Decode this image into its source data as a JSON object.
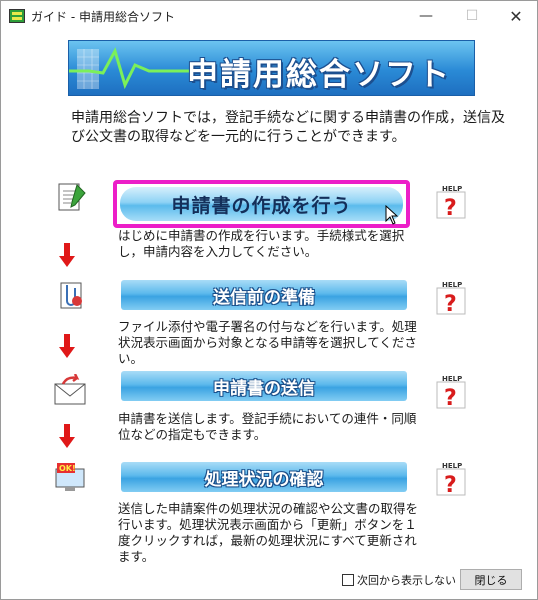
{
  "window": {
    "title": "ガイド - 申請用総合ソフト",
    "minimize_glyph": "—",
    "maximize_glyph": "☐",
    "close_glyph": "✕"
  },
  "banner": {
    "title": "申請用総合ソフト"
  },
  "intro": "申請用総合ソフトでは，登記手続などに関する申請書の作成，送信及び公文書の取得などを一元的に行うことができます。",
  "steps": [
    {
      "label": "申請書の作成を行う",
      "description": "はじめに申請書の作成を行います。手続様式を選択し，申請内容を入力してください。",
      "icon": "document-pencil-icon"
    },
    {
      "label": "送信前の準備",
      "description": "ファイル添付や電子署名の付与などを行います。処理状況表示画面から対象となる申請等を選択してください。",
      "icon": "paperclip-document-icon"
    },
    {
      "label": "申請書の送信",
      "description": "申請書を送信します。登記手続においての連件・同順位などの指定もできます。",
      "icon": "send-mail-icon"
    },
    {
      "label": "処理状況の確認",
      "description": "送信した申請案件の処理状況の確認や公文書の取得を行います。処理状況表示画面から「更新」ボタンを１度クリックすれば，最新の処理状況にすべて更新されます。",
      "icon": "ok-monitor-icon"
    }
  ],
  "help": {
    "label": "HELP",
    "glyph": "?"
  },
  "footer": {
    "checkbox_label": "次回から表示しない",
    "checkbox_checked": false,
    "close_label": "閉じる"
  },
  "colors": {
    "highlight": "#ec1ec8",
    "arrow": "#e01818",
    "button": "#3aa3e2"
  }
}
